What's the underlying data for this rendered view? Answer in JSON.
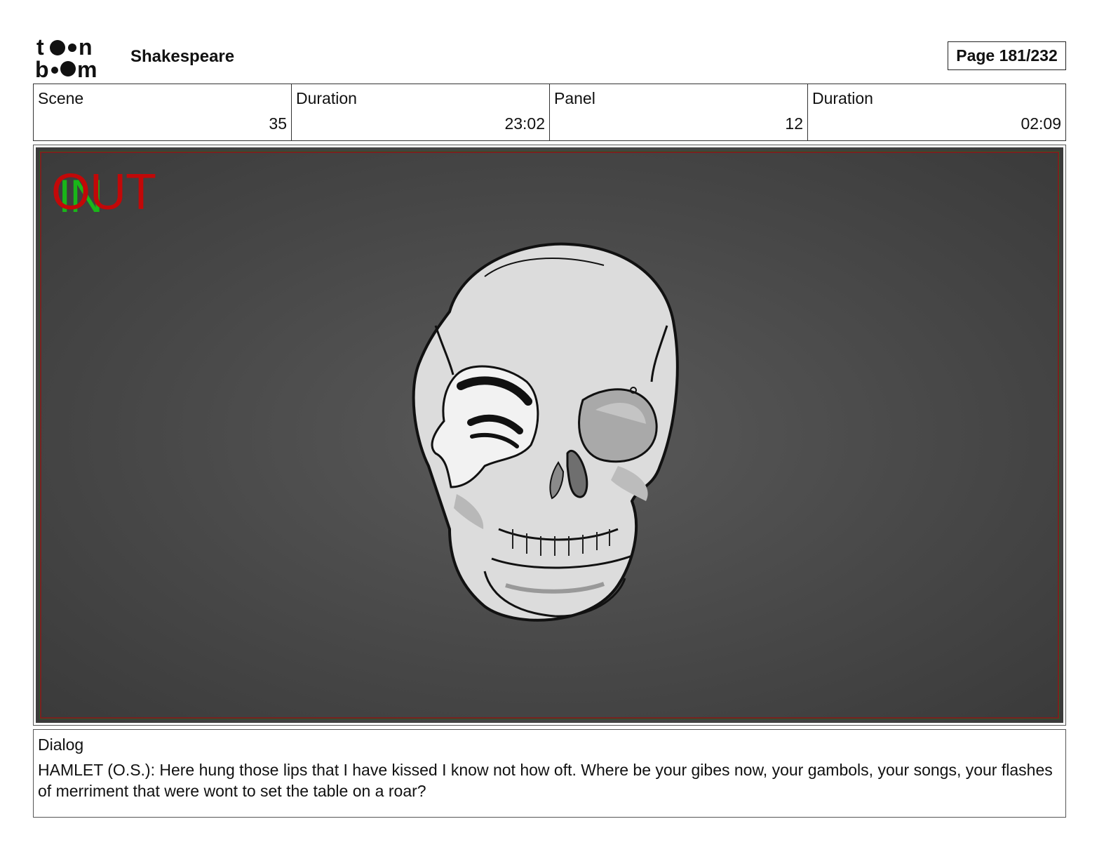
{
  "header": {
    "logo_text": "toon boom",
    "project_title": "Shakespeare",
    "page_label": "Page 181/232"
  },
  "info": {
    "scene_label": "Scene",
    "scene_value": "35",
    "scene_duration_label": "Duration",
    "scene_duration_value": "23:02",
    "panel_label": "Panel",
    "panel_value": "12",
    "panel_duration_label": "Duration",
    "panel_duration_value": "02:09"
  },
  "panel": {
    "marker_in": "IN",
    "marker_out": "OUT",
    "colors": {
      "in_marker": "#19b619",
      "out_marker": "#c20808",
      "background": "#4a4a4a"
    }
  },
  "dialog": {
    "label": "Dialog",
    "text": "HAMLET (O.S.): Here hung those lips that I have kissed I know not how oft.  Where be your gibes now, your gambols, your songs, your flashes of merriment that were wont to set the table on a roar?"
  }
}
